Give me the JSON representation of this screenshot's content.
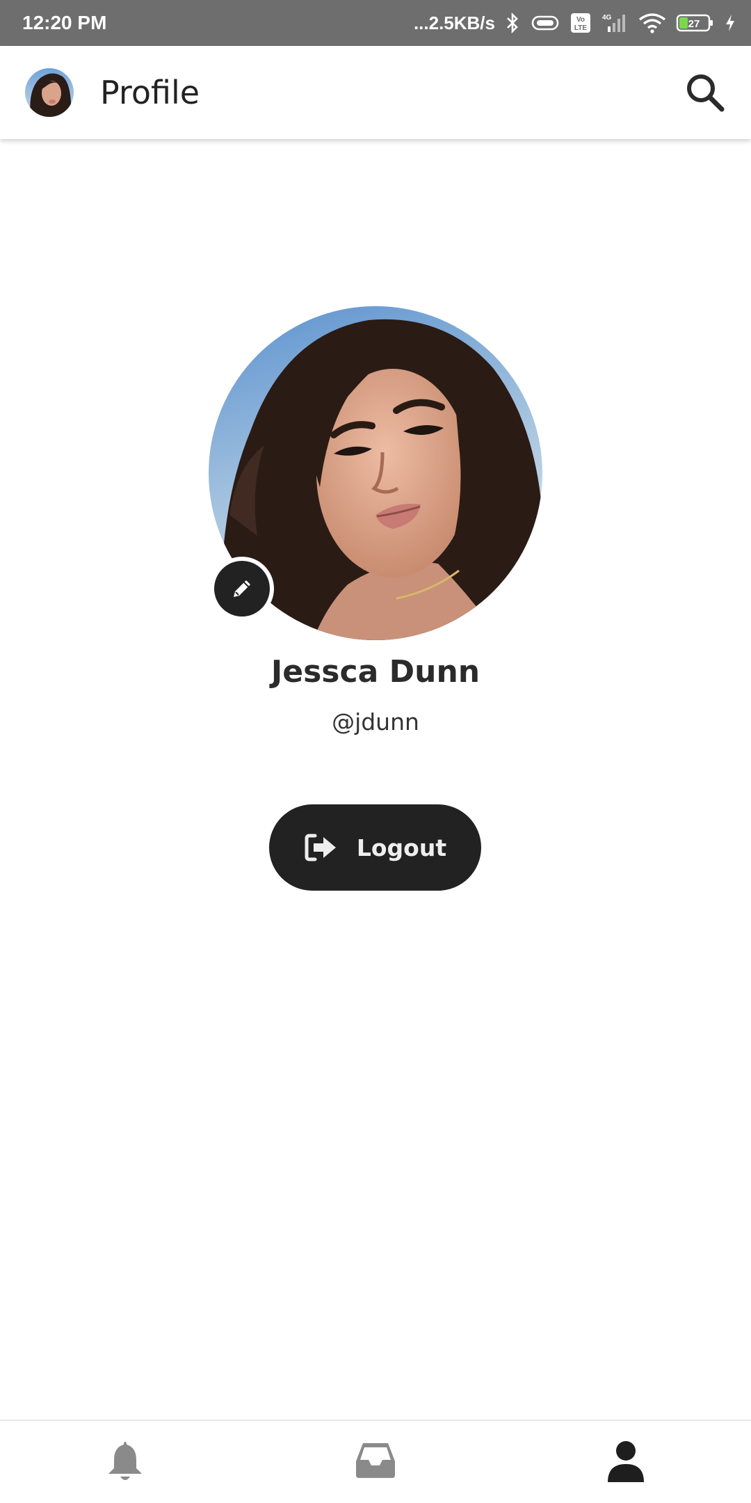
{
  "status_bar": {
    "time": "12:20 PM",
    "network_speed": "...2.5KB/s",
    "battery_level": "27",
    "volte_label": "Vo LTE",
    "network_type": "4G"
  },
  "app_bar": {
    "title": "Profile"
  },
  "profile": {
    "name": "Jessca Dunn",
    "handle": "@jdunn"
  },
  "actions": {
    "logout_label": "Logout"
  },
  "bottom_nav": {
    "items": [
      {
        "icon": "bell-icon",
        "active": false
      },
      {
        "icon": "inbox-icon",
        "active": false
      },
      {
        "icon": "user-icon",
        "active": true
      }
    ]
  },
  "colors": {
    "status_bar_bg": "#6e6e6e",
    "primary_dark": "#222222",
    "nav_inactive": "#8a8a8a",
    "nav_active": "#1e1e1e",
    "battery_green": "#7bd84a"
  }
}
